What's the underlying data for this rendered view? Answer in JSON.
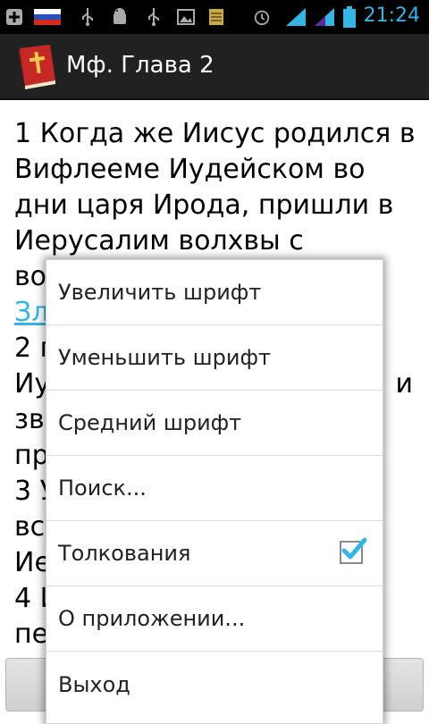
{
  "status_bar": {
    "time": "21:24",
    "icons": [
      "add-icon",
      "russian-flag-icon",
      "usb-icon",
      "android-debug-icon",
      "usb-icon",
      "image-icon",
      "notes-icon",
      "alarm-icon",
      "signal-icon",
      "signal-icon",
      "battery-icon"
    ]
  },
  "action_bar": {
    "title": "Мф. Глава 2"
  },
  "content": {
    "verse_1_text": "1 Когда же Иисус родился в Вифлееме Иудейском во дни царя Ирода, пришли в Иерусалим волхвы с востока",
    "verse_1_link": "Зл",
    "verse_2_start": "2 г",
    "line_iu": "Иу",
    "line_i": "и",
    "line_zv": "зв",
    "line_pr": "пр",
    "verse_3_start": "3 У",
    "line_vs": "вс",
    "line_ie": "Ие",
    "verse_4_start": "4 И",
    "line_pe": "пе"
  },
  "bottom_nav": {
    "prev_label": "<-",
    "next_label": "->"
  },
  "menu": {
    "items": [
      {
        "label": "Увеличить шрифт"
      },
      {
        "label": "Уменьшить шрифт"
      },
      {
        "label": "Средний шрифт"
      },
      {
        "label": "Поиск..."
      },
      {
        "label": "Толкования",
        "checked": true
      },
      {
        "label": "О приложении..."
      },
      {
        "label": "Выход"
      }
    ]
  },
  "colors": {
    "accent": "#33b5e5",
    "action_bar": "#212121"
  }
}
